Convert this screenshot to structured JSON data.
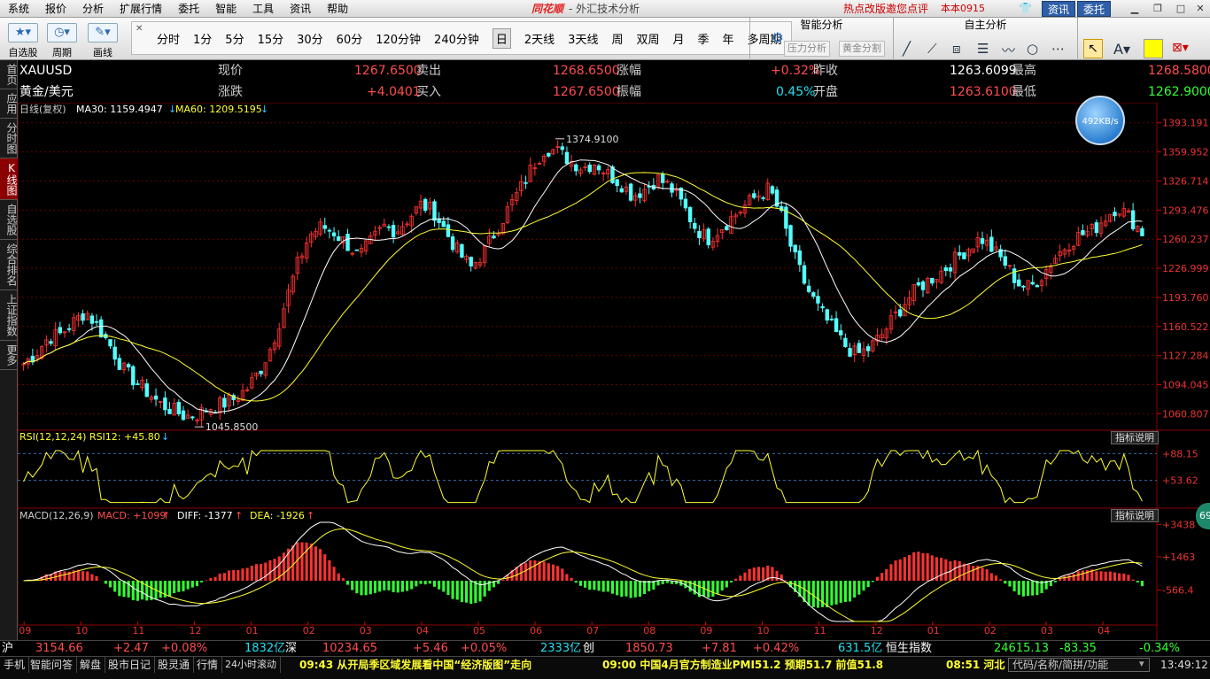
{
  "menu": {
    "items": [
      "系统",
      "报价",
      "分析",
      "扩展行情",
      "委托",
      "智能",
      "工具",
      "资讯",
      "帮助"
    ],
    "logo": "同花顺",
    "window_title": "- 外汇技术分析",
    "hot": "热点改版邀您点评",
    "version": "本本0915",
    "btn_news": "资讯",
    "btn_trade": "委托"
  },
  "toolbar": {
    "self_select": "自选股",
    "period": "周期",
    "draw": "画线",
    "periods": [
      "分时",
      "1分",
      "5分",
      "15分",
      "30分",
      "60分",
      "120分钟",
      "240分钟",
      "日",
      "2天线",
      "3天线",
      "周",
      "双周",
      "月",
      "季",
      "年",
      "多周期"
    ],
    "selected_period": "日",
    "smart_title": "智能分析",
    "smart_btn1": "压力分析",
    "smart_btn2": "黄金分割",
    "self_title": "自主分析",
    "color_accent": "#ffff00"
  },
  "sidebar": [
    "首页",
    "应用",
    "分时图",
    "K线图",
    "自选股",
    "综合排名",
    "上证指数",
    "更多"
  ],
  "quote": {
    "symbol": "XAUUSD",
    "name": "黄金/美元",
    "r1": [
      {
        "label": "现价",
        "value": "1267.6500"
      },
      {
        "label": "卖出",
        "value": "1268.6500"
      },
      {
        "label": "涨幅",
        "value": "+0.32%"
      },
      {
        "label": "昨收",
        "value": "1263.6099"
      },
      {
        "label": "最高",
        "value": "1268.5800"
      }
    ],
    "r2": [
      {
        "label": "涨跌",
        "value": "+4.0401"
      },
      {
        "label": "买入",
        "value": "1267.6500"
      },
      {
        "label": "振幅",
        "value": "0.45%"
      },
      {
        "label": "开盘",
        "value": "1263.6100"
      },
      {
        "label": "最低",
        "value": "1262.9000"
      }
    ]
  },
  "indicators": {
    "main": "日线(复权)",
    "ma30": "MA30: 1159.4947",
    "ma60": "MA60: 1209.5195",
    "rsi": "RSI(12,12,24)  RSI12: +45.80",
    "macd_name": "MACD(12,26,9)",
    "macd_val": "MACD: +1099",
    "diff": "DIFF: -1377",
    "dea": "DEA: -1926",
    "hint": "指标说明",
    "speed": "492KB/s",
    "side": "69"
  },
  "chart_data": {
    "type": "candlestick",
    "y_ticks": [
      "1393.191",
      "1359.952",
      "1326.714",
      "1293.476",
      "1260.237",
      "1226.999",
      "1193.760",
      "1160.522",
      "1127.284",
      "1094.045",
      "1060.807"
    ],
    "ylim": [
      1044,
      1400
    ],
    "rsi_ticks": [
      "88.15",
      "53.62"
    ],
    "macd_ticks": [
      "3438",
      "1463",
      "-566.4"
    ],
    "x_ticks": [
      "09",
      "10",
      "11",
      "12",
      "01",
      "02",
      "03",
      "04",
      "05",
      "06",
      "07",
      "08",
      "09",
      "10",
      "11",
      "12",
      "01",
      "02",
      "03",
      "04"
    ],
    "annotations": [
      {
        "text": "1374.9100",
        "value": 1374.91
      },
      {
        "text": "1045.8500",
        "value": 1045.85
      }
    ],
    "close_trend": [
      1118,
      1130,
      1148,
      1152,
      1165,
      1178,
      1160,
      1138,
      1112,
      1098,
      1085,
      1072,
      1065,
      1058,
      1060,
      1068,
      1072,
      1078,
      1090,
      1110,
      1140,
      1185,
      1230,
      1265,
      1275,
      1268,
      1255,
      1240,
      1258,
      1275,
      1270,
      1285,
      1300,
      1292,
      1268,
      1245,
      1228,
      1245,
      1270,
      1295,
      1318,
      1345,
      1365,
      1360,
      1350,
      1342,
      1348,
      1335,
      1325,
      1310,
      1318,
      1330,
      1320,
      1300,
      1275,
      1260,
      1272,
      1285,
      1298,
      1310,
      1318,
      1285,
      1240,
      1205,
      1180,
      1160,
      1140,
      1128,
      1135,
      1150,
      1170,
      1190,
      1205,
      1215,
      1225,
      1238,
      1250,
      1262,
      1248,
      1232,
      1210,
      1205,
      1220,
      1240,
      1255,
      1265,
      1270,
      1285,
      1298,
      1285,
      1268
    ]
  },
  "index_bar": [
    {
      "label": "沪",
      "value": "3154.66",
      "chg": "+2.47",
      "pct": "+0.08%",
      "amt": "1832亿"
    },
    {
      "label": "深",
      "value": "10234.65",
      "chg": "+5.46",
      "pct": "+0.05%",
      "amt": "2333亿"
    },
    {
      "label": "创",
      "value": "1850.73",
      "chg": "+7.81",
      "pct": "+0.42%",
      "amt": "631.5亿"
    },
    {
      "label": "恒生指数",
      "value": "24615.13",
      "chg": "-83.35",
      "pct": "-0.34%",
      "amt": ""
    }
  ],
  "status": {
    "buttons": [
      "手机",
      "智能问答",
      "解盘",
      "股市日记",
      "股灵通",
      "行情",
      "24小时滚动"
    ],
    "news1": "09:43 从开局季区域发展看中国“经济版图”走向",
    "news2": "09:00 中国4月官方制造业PMI51.2 预期51.7 前值51.8",
    "news3": "08:51 河北",
    "search_placeholder": "代码/名称/简拼/功能",
    "clock": "13:49:12"
  }
}
